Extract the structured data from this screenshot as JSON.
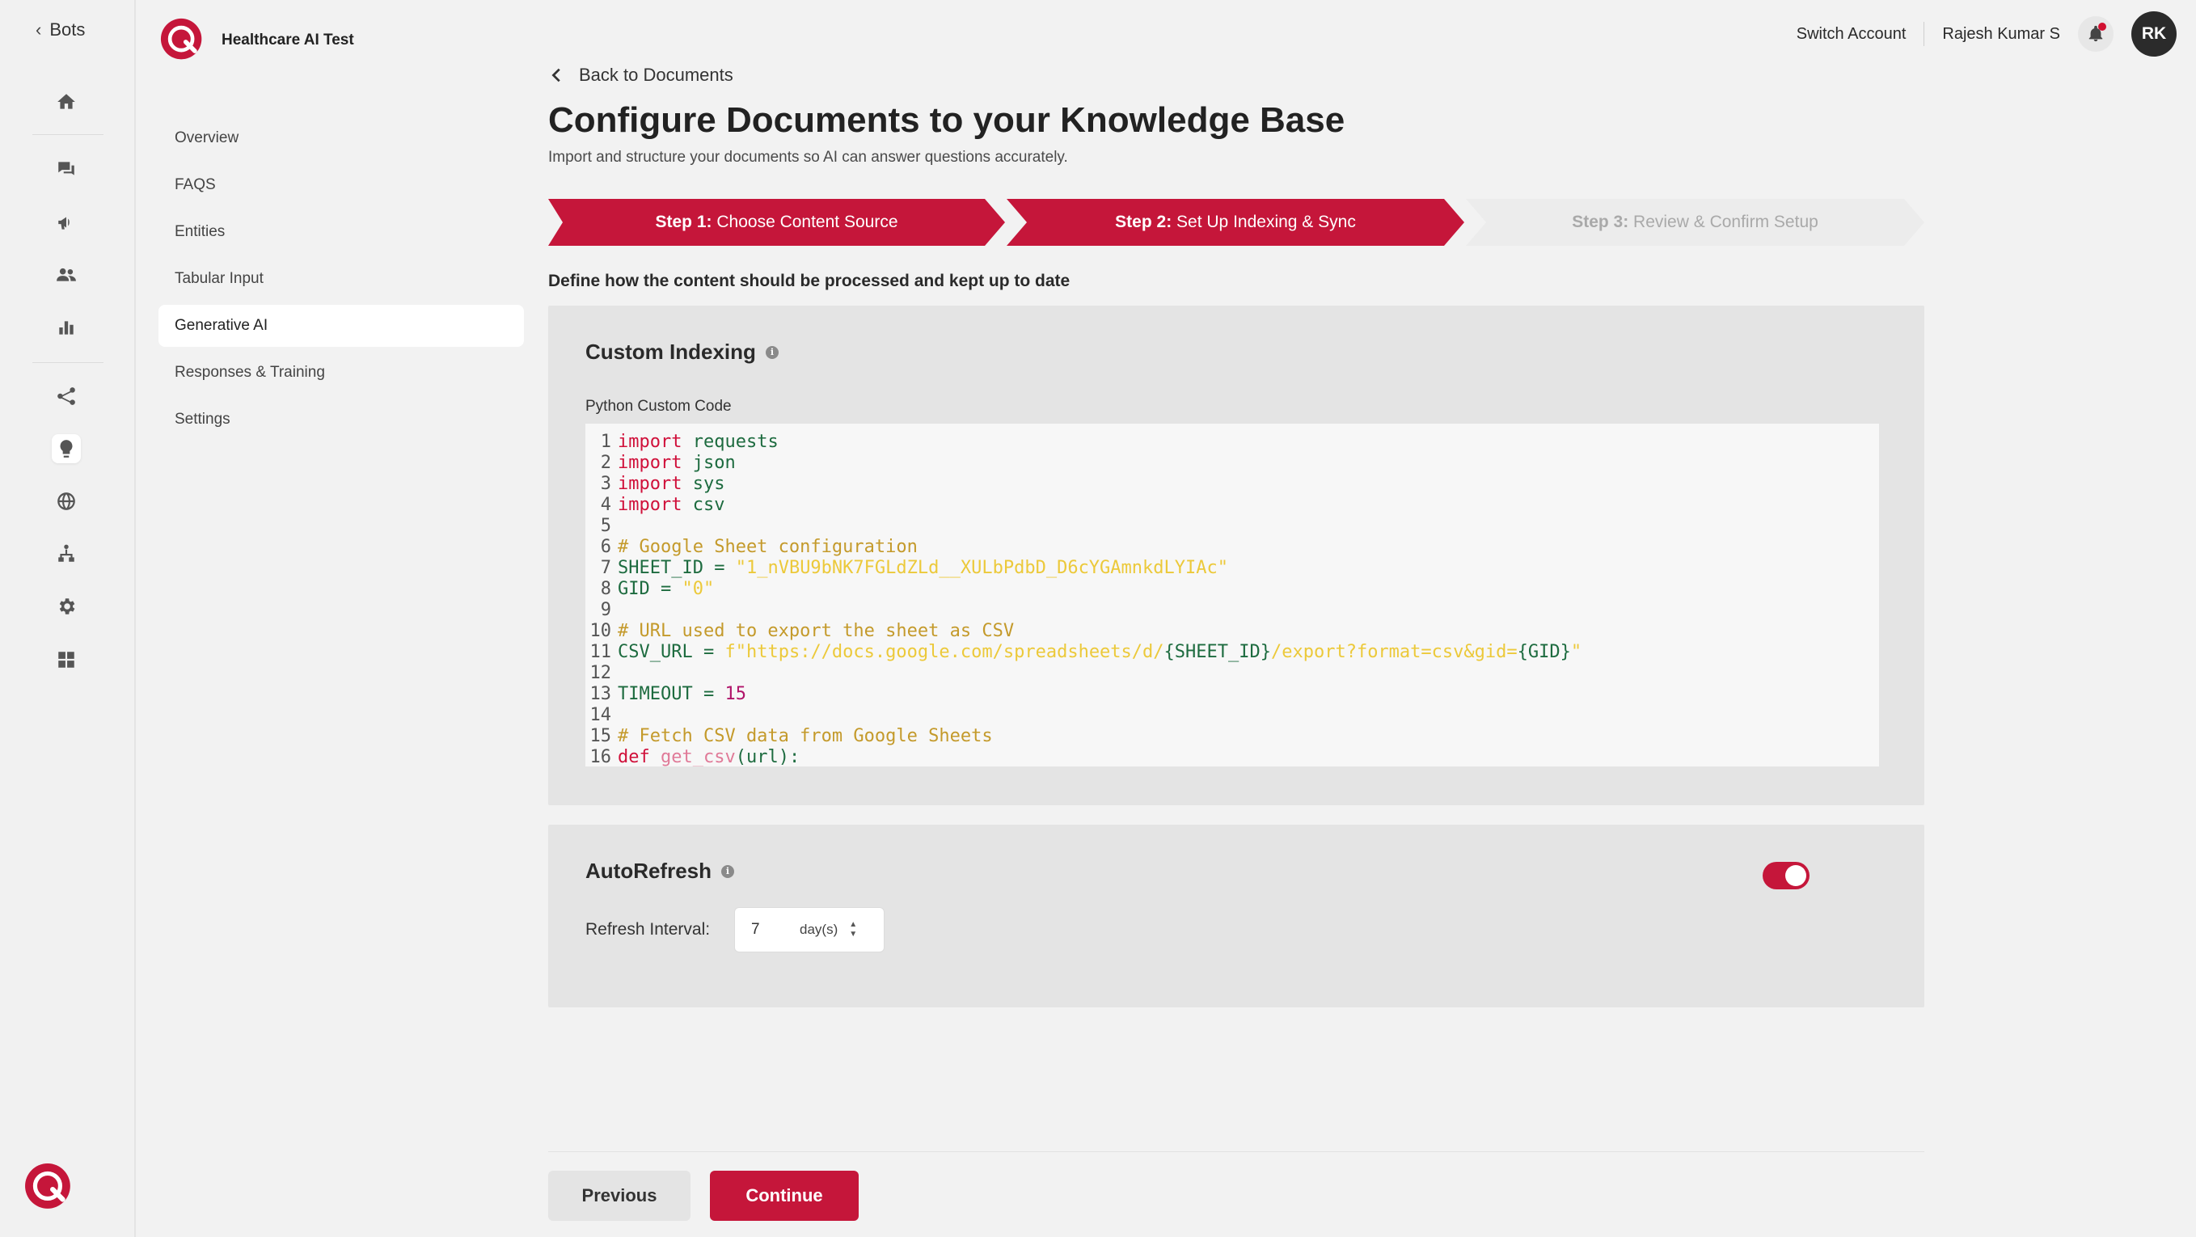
{
  "rail": {
    "back_label": "Bots",
    "icons": [
      "home-icon",
      "chat-icon",
      "megaphone-icon",
      "users-icon",
      "bar-chart-icon",
      "flow-icon",
      "lightbulb-icon",
      "globe-icon",
      "person-tree-icon",
      "gear-icon",
      "grid-icon"
    ]
  },
  "bot": {
    "name": "Healthcare AI Test"
  },
  "nav": {
    "items": [
      {
        "label": "Overview"
      },
      {
        "label": "FAQS"
      },
      {
        "label": "Entities"
      },
      {
        "label": "Tabular Input"
      },
      {
        "label": "Generative AI",
        "active": true
      },
      {
        "label": "Responses & Training"
      },
      {
        "label": "Settings"
      }
    ]
  },
  "topbar": {
    "switch_account": "Switch Account",
    "user_name": "Rajesh Kumar S",
    "avatar_initials": "RK"
  },
  "page": {
    "back_label": "Back to Documents",
    "title": "Configure Documents to your Knowledge Base",
    "subtitle": "Import and structure your documents so AI can answer questions accurately.",
    "steps": [
      {
        "prefix": "Step 1:",
        "label": "Choose Content Source",
        "state": "done"
      },
      {
        "prefix": "Step 2:",
        "label": "Set Up Indexing & Sync",
        "state": "current"
      },
      {
        "prefix": "Step 3:",
        "label": "Review & Confirm Setup",
        "state": "todo"
      }
    ],
    "define_text": "Define how the content should be processed and kept up to date"
  },
  "indexing": {
    "title": "Custom Indexing",
    "code_label": "Python Custom Code",
    "code_lines": [
      "import requests",
      "import json",
      "import sys",
      "import csv",
      "",
      "# Google Sheet configuration",
      "SHEET_ID = \"1_nVBU9bNK7FGLdZLd__XULbPdbD_D6cYGAmnkdLYIAc\"",
      "GID = \"0\"",
      "",
      "# URL used to export the sheet as CSV",
      "CSV_URL = f\"https://docs.google.com/spreadsheets/d/{SHEET_ID}/export?format=csv&gid={GID}\"",
      "",
      "TIMEOUT = 15",
      "",
      "# Fetch CSV data from Google Sheets",
      "def get_csv(url):"
    ]
  },
  "autorefresh": {
    "title": "AutoRefresh",
    "enabled": true,
    "interval_label": "Refresh Interval:",
    "interval_value": "7",
    "interval_unit": "day(s)"
  },
  "actions": {
    "previous": "Previous",
    "continue": "Continue"
  },
  "colors": {
    "brand": "#c5163a",
    "background": "#f2f2f2",
    "panel": "#e4e4e4"
  }
}
